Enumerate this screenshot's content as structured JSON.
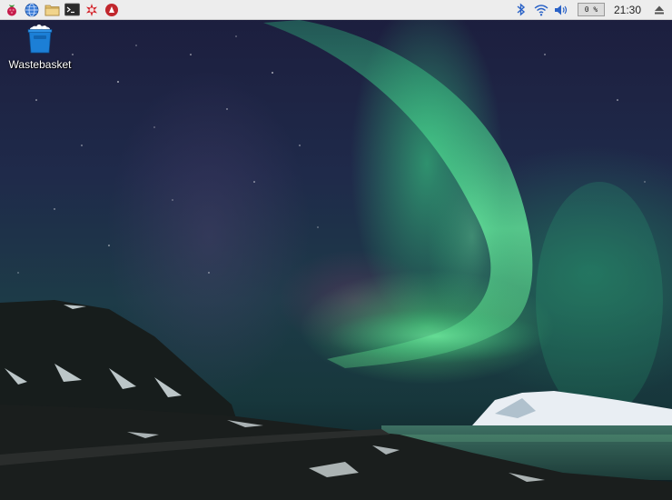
{
  "panel": {
    "launcher": [
      {
        "name": "menu",
        "icon": "raspberry-menu-icon"
      },
      {
        "name": "web-browser",
        "icon": "globe-icon"
      },
      {
        "name": "file-manager",
        "icon": "folder-icon"
      },
      {
        "name": "terminal",
        "icon": "terminal-icon"
      },
      {
        "name": "app",
        "icon": "red-star-icon"
      },
      {
        "name": "app2",
        "icon": "red-circle-icon"
      }
    ],
    "tray": {
      "bluetooth": "bluetooth-icon",
      "wifi": "wifi-icon",
      "volume": "volume-icon",
      "cpu_usage": "0 %",
      "clock": "21:30",
      "eject": "eject-icon"
    }
  },
  "desktop": {
    "icons": [
      {
        "label": "Wastebasket",
        "icon": "wastebasket-icon"
      }
    ]
  }
}
